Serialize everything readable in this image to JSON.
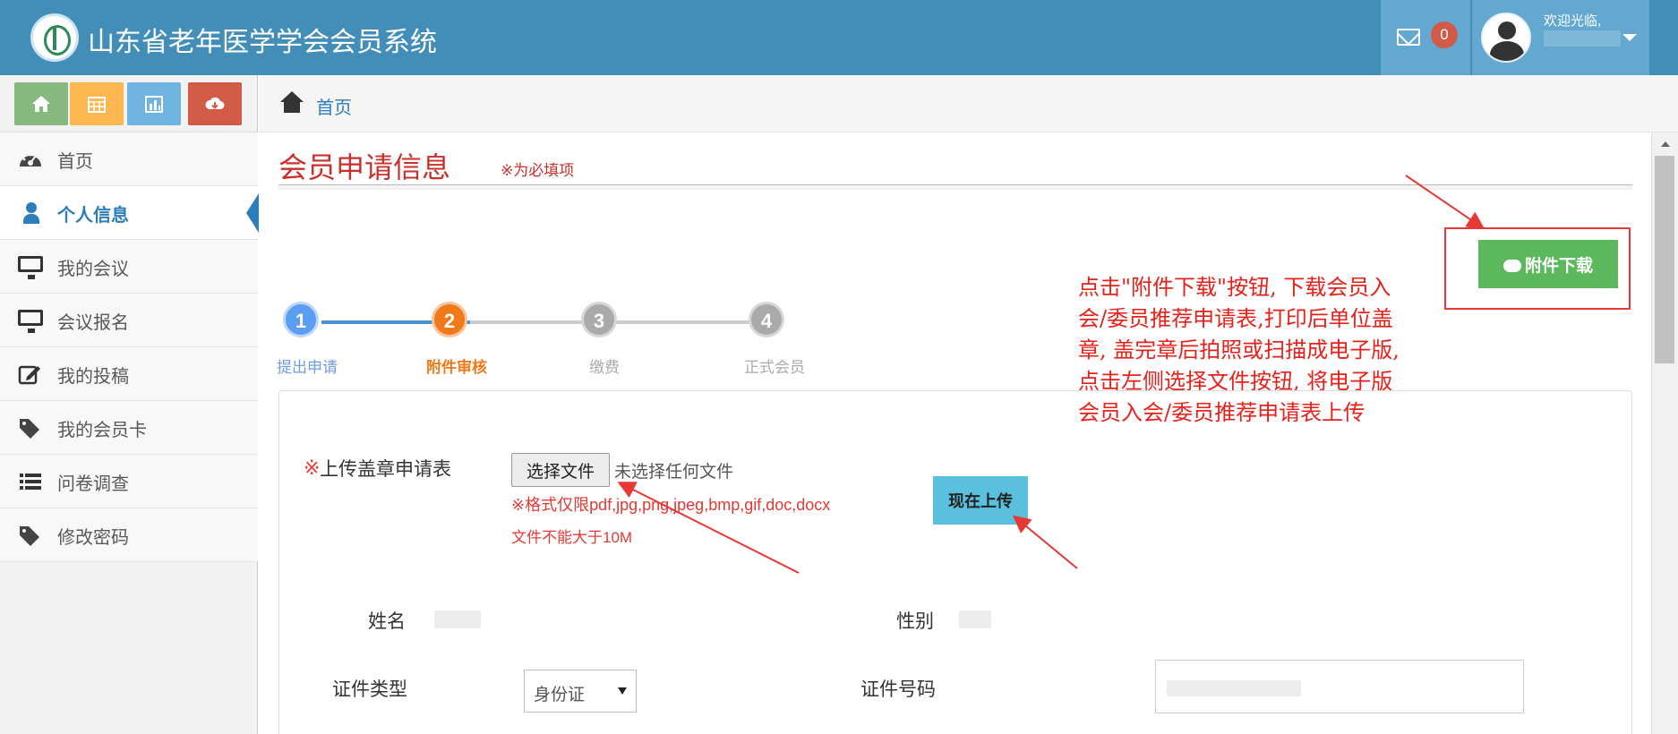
{
  "app": {
    "title": "山东省老年医学学会会员系统",
    "welcome": "欢迎光临,",
    "unread_count": "0"
  },
  "sidebar": {
    "shortcuts": [
      "home-icon",
      "calendar-icon",
      "bar-chart-icon",
      "cloud-download-icon"
    ],
    "items": [
      {
        "label": "首页",
        "icon": "dashboard-icon"
      },
      {
        "label": "个人信息",
        "icon": "user-icon",
        "active": true
      },
      {
        "label": "我的会议",
        "icon": "monitor-icon"
      },
      {
        "label": "会议报名",
        "icon": "monitor-icon"
      },
      {
        "label": "我的投稿",
        "icon": "edit-icon"
      },
      {
        "label": "我的会员卡",
        "icon": "tag-icon"
      },
      {
        "label": "问卷调查",
        "icon": "list-icon"
      },
      {
        "label": "修改密码",
        "icon": "tag-icon"
      }
    ]
  },
  "breadcrumb": {
    "home": "首页"
  },
  "main": {
    "title": "会员申请信息",
    "required_note": "※为必填项",
    "download_button": "附件下载",
    "annotation": "点击\"附件下载\"按钮, 下载会员入会/委员推荐申请表,打印后单位盖章, 盖完章后拍照或扫描成电子版, 点击左侧选择文件按钮, 将电子版会员入会/委员推荐申请表上传",
    "steps": [
      {
        "num": "1",
        "label": "提出申请",
        "state": "done"
      },
      {
        "num": "2",
        "label": "附件审核",
        "state": "current"
      },
      {
        "num": "3",
        "label": "缴费",
        "state": "pending"
      },
      {
        "num": "4",
        "label": "正式会员",
        "state": "pending"
      }
    ],
    "form": {
      "required_star": "※",
      "upload_label": "上传盖章申请表",
      "choose_file": "选择文件",
      "no_file": "未选择任何文件",
      "format_hint": "※格式仅限pdf,jpg,png,jpeg,bmp,gif,doc,docx",
      "size_hint": "文件不能大于10M",
      "upload_now": "现在上传",
      "name_label": "姓名",
      "gender_label": "性别",
      "id_type_label": "证件类型",
      "id_type_value": "身份证",
      "id_number_label": "证件号码"
    }
  },
  "colors": {
    "header": "#438eb9",
    "accent_red": "#e53935",
    "download_green": "#5cb85c",
    "upload_blue": "#5bc0de",
    "step_blue": "#5b9df0",
    "step_orange": "#f07a1a"
  }
}
